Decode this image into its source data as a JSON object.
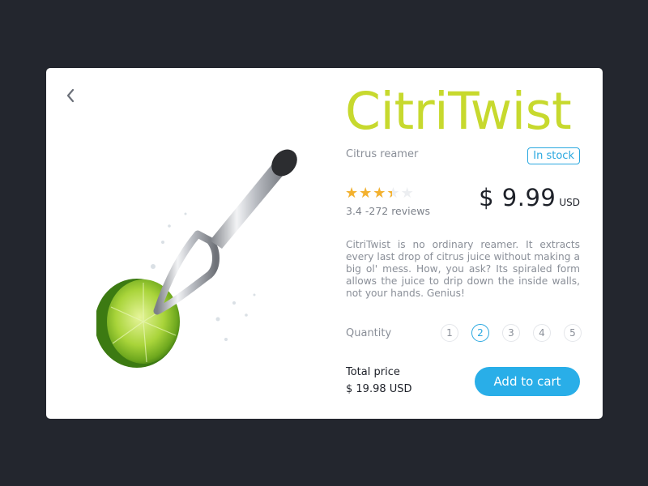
{
  "theme": {
    "accent": "#c7d92e",
    "link_blue": "#2aa8e0",
    "button_blue": "#29aee8",
    "star_on": "#f3b12f",
    "star_off": "#eceef1"
  },
  "nav": {
    "back_icon": "chevron-left-icon"
  },
  "product": {
    "name": "CitriTwist",
    "category": "Citrus reamer",
    "stock_status": "In stock",
    "rating": 3.4,
    "rating_max": 5,
    "reviews_text": "3.4 -272 reviews",
    "price": "$ 9.99",
    "currency": "USD",
    "description": "CitriTwist is no ordinary reamer. It extracts every last drop of citrus juice without making a big ol' mess. How, you ask? Its spiraled form allows the juice to drip down the inside walls, not your hands. Genius!",
    "image_icon": "citrus-reamer-with-lime"
  },
  "quantity": {
    "label": "Quantity",
    "options": [
      "1",
      "2",
      "3",
      "4",
      "5"
    ],
    "selected": "2"
  },
  "total": {
    "label": "Total price",
    "value": "$ 19.98 USD"
  },
  "cart": {
    "button_label": "Add to cart"
  }
}
